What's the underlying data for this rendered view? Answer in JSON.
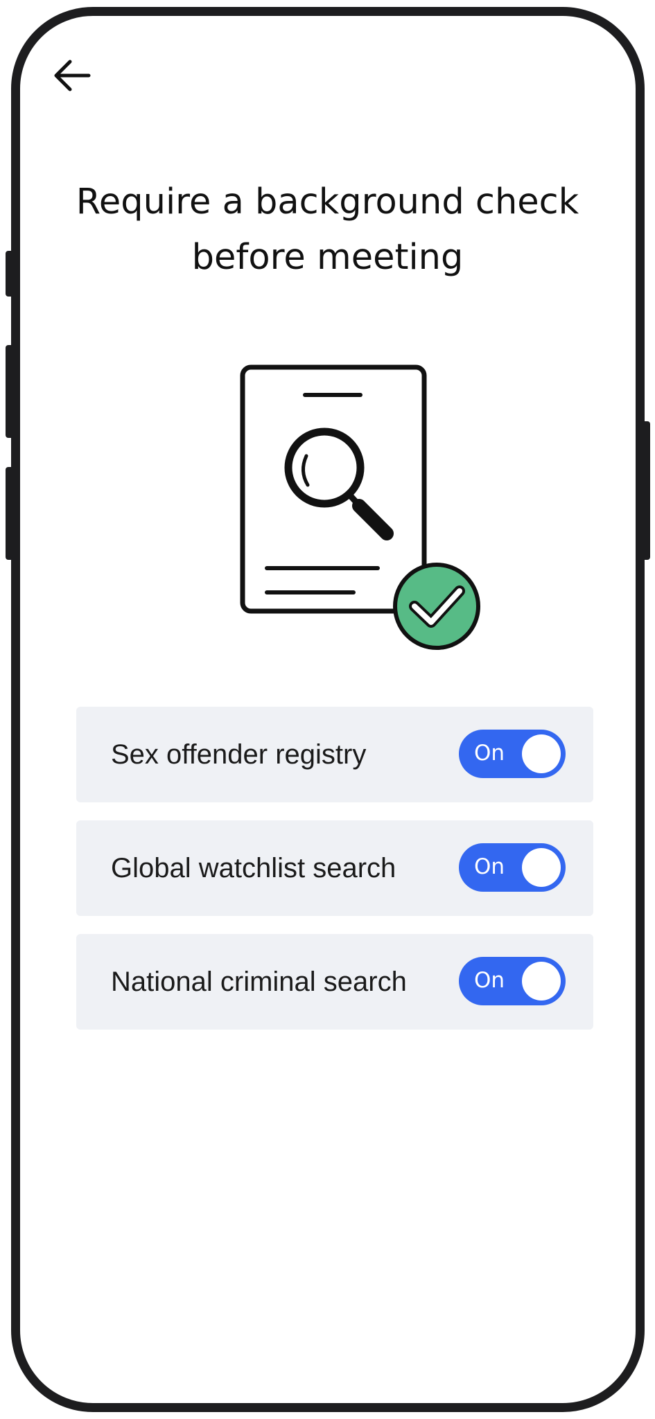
{
  "header": {
    "back_icon": "arrow-left-icon",
    "title": "Require a background check before meeting"
  },
  "illustration": {
    "icon": "document-search-check-icon",
    "check_color": "#57bb86"
  },
  "options": [
    {
      "label": "Sex offender registry",
      "toggle_label": "On",
      "enabled": true
    },
    {
      "label": "Global watchlist search",
      "toggle_label": "On",
      "enabled": true
    },
    {
      "label": "National criminal search",
      "toggle_label": "On",
      "enabled": true
    }
  ],
  "colors": {
    "toggle_on": "#3367f0",
    "row_background": "#eff1f5",
    "frame": "#1d1d1f"
  }
}
